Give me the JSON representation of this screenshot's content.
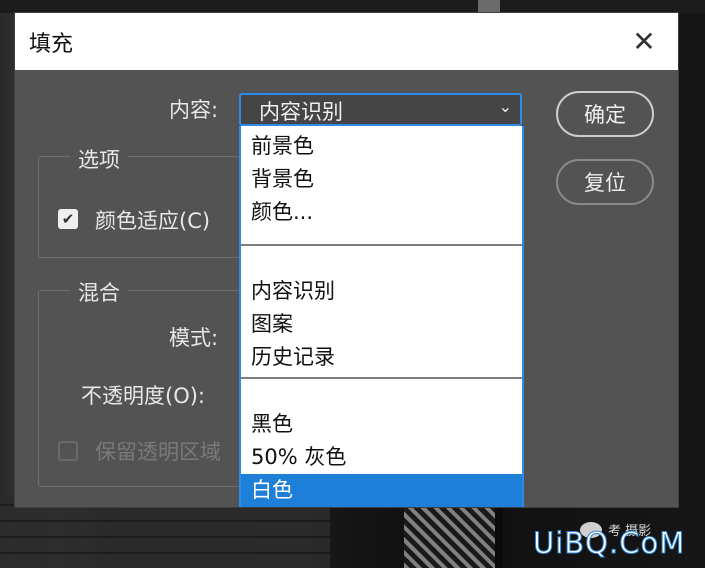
{
  "dialog": {
    "title": "填充",
    "close_glyph": "✕"
  },
  "content": {
    "label": "内容:",
    "selected": "内容识别",
    "chevron": "⌄"
  },
  "options_group": {
    "title": "选项",
    "color_adapt": {
      "label": "颜色适应(C)",
      "checked": true
    }
  },
  "blend_group": {
    "title": "混合",
    "mode_label": "模式:",
    "opacity_label": "不透明度(O):",
    "preserve": {
      "label": "保留透明区域",
      "checked": false,
      "disabled": true
    }
  },
  "buttons": {
    "ok": "确定",
    "reset": "复位"
  },
  "dropdown": {
    "groups": [
      [
        "前景色",
        "背景色",
        "颜色..."
      ],
      [
        "内容识别",
        "图案",
        "历史记录"
      ],
      [
        "黑色",
        "50% 灰色",
        "白色"
      ]
    ],
    "highlighted": "白色"
  },
  "watermark": {
    "text": "UiBQ.CoM",
    "cn": "考 摄影"
  },
  "colors": {
    "dialog_bg": "#535353",
    "accent": "#2d8ceb",
    "highlight": "#1e7fd9"
  }
}
